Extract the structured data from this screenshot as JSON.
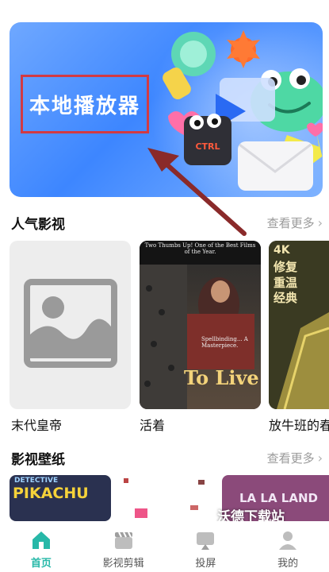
{
  "banner": {
    "title": "本地播放器",
    "key_label": "CTRL"
  },
  "popular": {
    "title": "人气影视",
    "more": "查看更多",
    "items": [
      {
        "label": "末代皇帝"
      },
      {
        "label": "活着",
        "poster_quote": "Two Thumbs Up! One of the Best Films of the Year.",
        "poster_title": "To Live",
        "poster_review": "Spellbinding... A Masterpiece."
      },
      {
        "label": "放牛班的春",
        "poster_tag": "4K",
        "poster_text": "修复 重温经典"
      }
    ]
  },
  "wallpapers": {
    "title": "影视壁纸",
    "more": "查看更多",
    "items": [
      {
        "text": "PIKACHU",
        "subtext": "DETECTIVE"
      },
      {
        "text": ""
      },
      {
        "text": ""
      },
      {
        "text": "LA LA LAND"
      }
    ],
    "overlay_text": "沃德下载站"
  },
  "nav": {
    "items": [
      {
        "label": "首页",
        "icon": "home-icon",
        "active": true
      },
      {
        "label": "影视剪辑",
        "icon": "clapper-icon"
      },
      {
        "label": "投屏",
        "icon": "cast-icon"
      },
      {
        "label": "我的",
        "icon": "user-icon"
      }
    ]
  },
  "colors": {
    "accent": "#27b8a8",
    "banner_blue": "#3d86ff",
    "highlight_red": "#d23a43"
  }
}
